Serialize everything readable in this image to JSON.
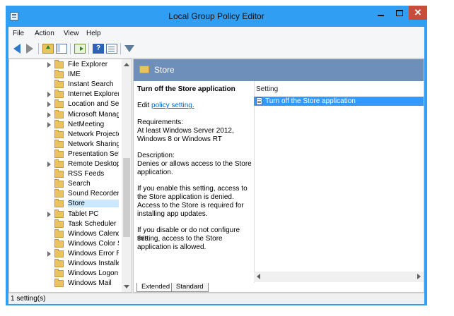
{
  "window": {
    "title": "Local Group Policy Editor",
    "close_glyph": "✕"
  },
  "menu": {
    "items": [
      "File",
      "Action",
      "View",
      "Help"
    ]
  },
  "toolbar": {
    "help_glyph": "?"
  },
  "tree": {
    "items": [
      {
        "label": "File Explorer",
        "expandable": true
      },
      {
        "label": "IME",
        "expandable": false
      },
      {
        "label": "Instant Search",
        "expandable": false
      },
      {
        "label": "Internet Explorer",
        "expandable": true
      },
      {
        "label": "Location and Sensors",
        "expandable": true
      },
      {
        "label": "Microsoft Management Console",
        "expandable": true
      },
      {
        "label": "NetMeeting",
        "expandable": true
      },
      {
        "label": "Network Projector",
        "expandable": false
      },
      {
        "label": "Network Sharing",
        "expandable": false
      },
      {
        "label": "Presentation Settings",
        "expandable": false
      },
      {
        "label": "Remote Desktop Services",
        "expandable": true
      },
      {
        "label": "RSS Feeds",
        "expandable": false
      },
      {
        "label": "Search",
        "expandable": false
      },
      {
        "label": "Sound Recorder",
        "expandable": false
      },
      {
        "label": "Store",
        "expandable": false,
        "selected": true
      },
      {
        "label": "Tablet PC",
        "expandable": true
      },
      {
        "label": "Task Scheduler",
        "expandable": false
      },
      {
        "label": "Windows Calendar",
        "expandable": false
      },
      {
        "label": "Windows Color System",
        "expandable": false
      },
      {
        "label": "Windows Error Reporting",
        "expandable": true
      },
      {
        "label": "Windows Installer",
        "expandable": false
      },
      {
        "label": "Windows Logon Options",
        "expandable": false
      },
      {
        "label": "Windows Mail",
        "expandable": false
      }
    ]
  },
  "header": {
    "title": "Store"
  },
  "extended": {
    "title": "Turn off the Store application",
    "edit_prefix": "Edit ",
    "edit_link": "policy setting.",
    "lines": [
      "Requirements:",
      "At least Windows Server 2012,",
      "Windows 8 or Windows RT",
      "",
      "Description:",
      "Denies or allows access to the Store",
      "application.",
      "",
      "If you enable this setting, access to",
      "the Store application is denied.",
      "Access to the Store is required for",
      "installing app updates.",
      "",
      "If you disable or do not configure this",
      "setting, access to the Store",
      "application is allowed."
    ]
  },
  "list": {
    "column": "Setting",
    "rows": [
      "Turn off the Store application"
    ]
  },
  "tabs": [
    "Extended",
    "Standard"
  ],
  "status": {
    "text": "1 setting(s)"
  }
}
